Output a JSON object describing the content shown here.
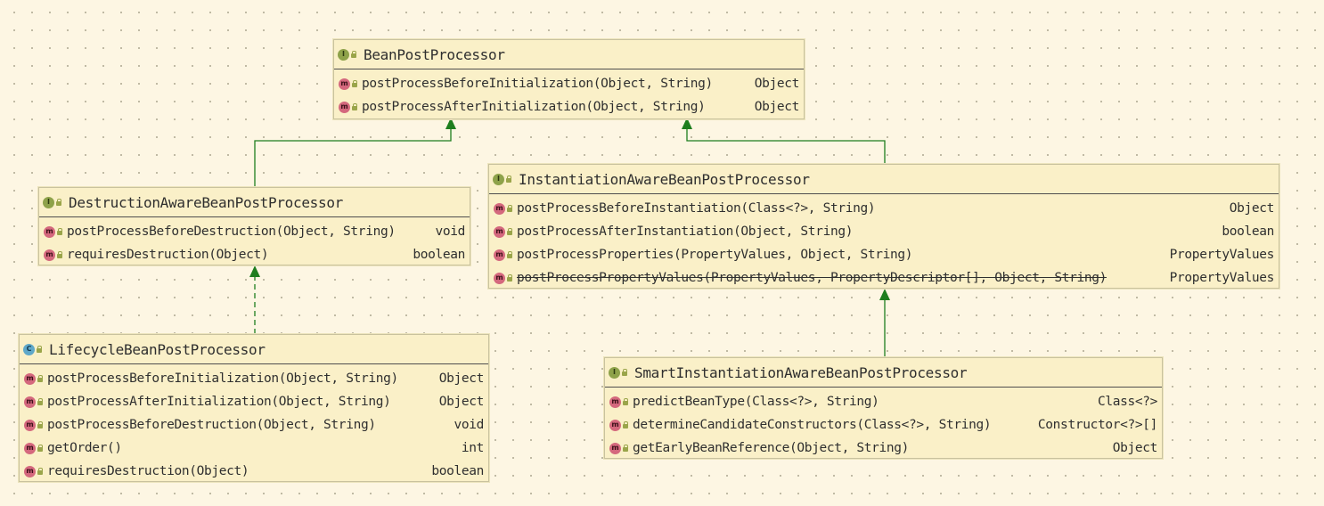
{
  "colors": {
    "background": "#fdf6e3",
    "box_fill": "#faf0c8",
    "arrow": "#1e7e1e",
    "interface_icon": "#8ea24a",
    "class_icon": "#5fa8c9",
    "method_icon": "#d4687d"
  },
  "boxes": {
    "bpp": {
      "kind_icon": "I",
      "name": "BeanPostProcessor",
      "methods": [
        {
          "icon": "m",
          "signature": "postProcessBeforeInitialization(Object, String)",
          "return": "Object"
        },
        {
          "icon": "m",
          "signature": "postProcessAfterInitialization(Object, String)",
          "return": "Object"
        }
      ]
    },
    "dabpp": {
      "kind_icon": "I",
      "name": "DestructionAwareBeanPostProcessor",
      "methods": [
        {
          "icon": "m",
          "signature": "postProcessBeforeDestruction(Object, String)",
          "return": "void"
        },
        {
          "icon": "m",
          "signature": "requiresDestruction(Object)",
          "return": "boolean"
        }
      ]
    },
    "iabpp": {
      "kind_icon": "I",
      "name": "InstantiationAwareBeanPostProcessor",
      "methods": [
        {
          "icon": "m",
          "signature": "postProcessBeforeInstantiation(Class<?>, String)",
          "return": "Object"
        },
        {
          "icon": "m",
          "signature": "postProcessAfterInstantiation(Object, String)",
          "return": "boolean"
        },
        {
          "icon": "m",
          "signature": "postProcessProperties(PropertyValues, Object, String)",
          "return": "PropertyValues"
        },
        {
          "icon": "m",
          "signature": "postProcessPropertyValues(PropertyValues, PropertyDescriptor[], Object, String)",
          "return": "PropertyValues"
        }
      ]
    },
    "lbpp": {
      "kind_icon": "C",
      "name": "LifecycleBeanPostProcessor",
      "methods": [
        {
          "icon": "m",
          "signature": "postProcessBeforeInitialization(Object, String)",
          "return": "Object"
        },
        {
          "icon": "m",
          "signature": "postProcessAfterInitialization(Object, String)",
          "return": "Object"
        },
        {
          "icon": "m",
          "signature": "postProcessBeforeDestruction(Object, String)",
          "return": "void"
        },
        {
          "icon": "m",
          "signature": "getOrder()",
          "return": "int"
        },
        {
          "icon": "m",
          "signature": "requiresDestruction(Object)",
          "return": "boolean"
        }
      ]
    },
    "siabpp": {
      "kind_icon": "I",
      "name": "SmartInstantiationAwareBeanPostProcessor",
      "methods": [
        {
          "icon": "m",
          "signature": "predictBeanType(Class<?>, String)",
          "return": "Class<?>"
        },
        {
          "icon": "m",
          "signature": "determineCandidateConstructors(Class<?>, String)",
          "return": "Constructor<?>[]"
        },
        {
          "icon": "m",
          "signature": "getEarlyBeanReference(Object, String)",
          "return": "Object"
        }
      ]
    }
  }
}
